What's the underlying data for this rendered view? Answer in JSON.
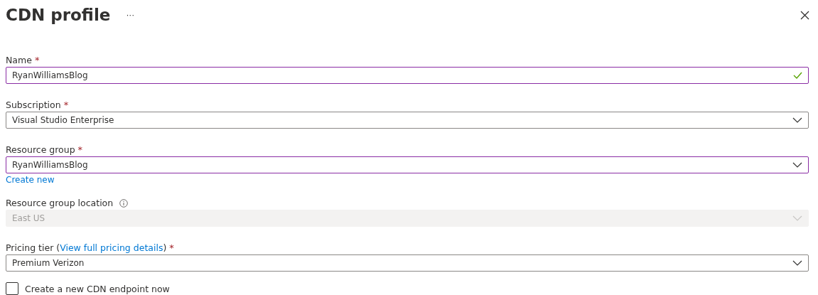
{
  "header": {
    "title": "CDN profile",
    "more": "···"
  },
  "fields": [
    {
      "kind": "text",
      "label": "Name",
      "required": "*",
      "value": "RyanWilliamsBlog",
      "focused": true,
      "valid": true,
      "disabled": false
    },
    {
      "kind": "select",
      "label": "Subscription",
      "required": "*",
      "value": "Visual Studio Enterprise",
      "focused": false,
      "disabled": false
    },
    {
      "kind": "select",
      "label": "Resource group",
      "required": "*",
      "value": "RyanWilliamsBlog",
      "focused": true,
      "disabled": false,
      "link": "Create new"
    },
    {
      "kind": "select",
      "label": "Resource group location",
      "info": true,
      "value": "East US",
      "focused": false,
      "disabled": true
    },
    {
      "kind": "select",
      "label": "Pricing tier (",
      "label_link": "View full pricing details",
      "label_after": ")",
      "required": "*",
      "value": "Premium Verizon",
      "focused": false,
      "disabled": false
    }
  ],
  "checkbox": {
    "label": "Create a new CDN endpoint now",
    "checked": false
  }
}
